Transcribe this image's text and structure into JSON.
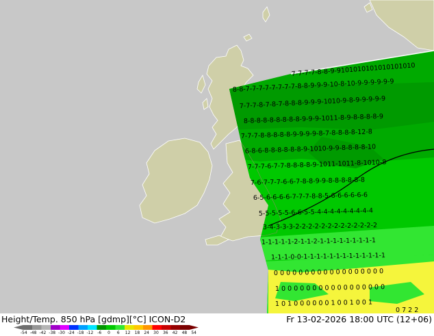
{
  "footer": {
    "title": "Height/Temp. 850 hPa [gdmp][°C] ICON-D2",
    "datetime": "Fr 13-02-2026 18:00 UTC (12+06)"
  },
  "colorbar": {
    "ticks": [
      "-54",
      "-48",
      "-42",
      "-38",
      "-30",
      "-24",
      "-18",
      "-12",
      "-6",
      "0",
      "6",
      "12",
      "18",
      "24",
      "30",
      "36",
      "42",
      "48",
      "54"
    ],
    "colors": [
      "#6e6e6e",
      "#969696",
      "#b4b4b4",
      "#a000c8",
      "#e000ff",
      "#0032ff",
      "#00a0ff",
      "#00e6ff",
      "#009600",
      "#00c800",
      "#32e632",
      "#e6e600",
      "#ffc800",
      "#ff9600",
      "#ff0000",
      "#c80000",
      "#960000",
      "#7a0000"
    ]
  },
  "colors": {
    "sea": "#c8c8c8",
    "land": "#cfcfa8",
    "field_green_dark": "#009a00",
    "field_green": "#00c800",
    "field_green_light": "#32e632",
    "field_yellow": "#f5f53c"
  },
  "labels": {
    "rows": [
      "7-7-7-7-8-8-9-9101010101010101010",
      "8-8-7-7-7-7-7-7-7-7-8-8-9-9-9-10-8-10-9-9-9-9-9-9",
      "7-7-7-8-7-8-7-8-8-8-9-9-9-1010-9-8-9-9-9-9-9",
      "8-8-8-8-8-8-8-8-8-9-9-9-1011-8-9-8-8-8-8-9",
      "7-7-7-8-8-8-8-8-9-9-9-9-8-7-8-8-8-8-12-8",
      "6-8-6-8-8-8-8-8-8-9-1010-9-9-8-8-8-8-10",
      "7-7-7-6-7-7-8-8-8-8-9-1011-1011-8-1010-8",
      "7-6-7-7-7-6-6-7-8-8-9-9-8-8-8-8-8-8",
      "6-5-6-6-6-6-7-7-7-8-8-5-6-6-6-6-6-6",
      "5-5-5-5-5-6-6-5-5-4-4-4-4-4-4-4-4-4",
      "3-4-3-3-3-2-2-2-2-2-2-2-2-2-2-2-2-2",
      "1-1-1-1-1-2-1-1-2-1-1-1-1-1-1-1-1-1",
      "1-1-1-0-0-1-1-1-1-1-1-1-1-1-1-1-1-1",
      "0 0 0 0 0 0 0 0 0 0 0 0 0 0 0 0 0 0",
      "1 0 0 0 0 0 0 0 0 0 0 0 0 0 0 0 0 0",
      "1 0 1 0 0 0 0 0 0 1 0 0 1 0 0 1",
      "0 7 2 2"
    ]
  }
}
